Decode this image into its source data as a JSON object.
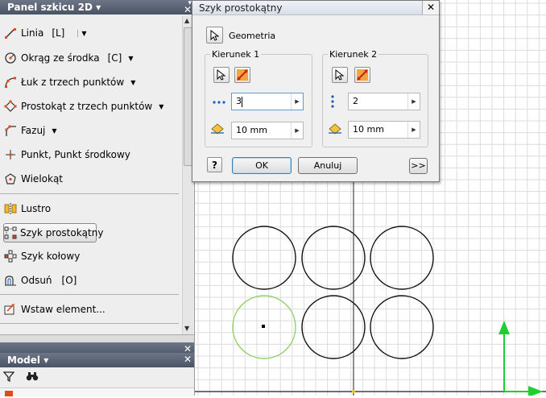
{
  "sketch_panel": {
    "title": "Panel szkicu 2D ▾",
    "tools": [
      {
        "label": "Linia",
        "shortcut": "[L]",
        "dropdown": true
      },
      {
        "label": "Okrąg ze środka",
        "shortcut": "[C]",
        "dropdown": true
      },
      {
        "label": "Łuk z trzech punktów",
        "shortcut": "",
        "dropdown": true
      },
      {
        "label": "Prostokąt z trzech punktów",
        "shortcut": "",
        "dropdown": true
      },
      {
        "label": "Fazuj",
        "shortcut": "",
        "dropdown": true
      },
      {
        "label": "Punkt, Punkt środkowy",
        "shortcut": "",
        "dropdown": false
      },
      {
        "label": "Wielokąt",
        "shortcut": "",
        "dropdown": false
      },
      {
        "label": "Lustro",
        "shortcut": "",
        "dropdown": false
      },
      {
        "label": "Szyk prostokątny",
        "shortcut": "",
        "dropdown": false,
        "selected": true
      },
      {
        "label": "Szyk kołowy",
        "shortcut": "",
        "dropdown": false
      },
      {
        "label": "Odsuń",
        "shortcut": "[O]",
        "dropdown": false
      },
      {
        "label": "Wstaw element...",
        "shortcut": "",
        "dropdown": false
      }
    ]
  },
  "model_panel": {
    "title": "Model ▾"
  },
  "dialog": {
    "title": "Szyk prostokątny",
    "geometry_label": "Geometria",
    "direction1": {
      "label": "Kierunek 1",
      "count": "3",
      "spacing": "10 mm"
    },
    "direction2": {
      "label": "Kierunek 2",
      "count": "2",
      "spacing": "10 mm"
    },
    "ok_label": "OK",
    "cancel_label": "Anuluj",
    "more_label": ">>",
    "help_icon": "?",
    "close_icon": "✕"
  },
  "colors": {
    "panel_title": "#4a5363",
    "grid_line": "#dcdcdc",
    "selected_circle": "#8fd16a",
    "axis_green": "#1fcf2f",
    "accent_orange": "#e24a1a"
  }
}
